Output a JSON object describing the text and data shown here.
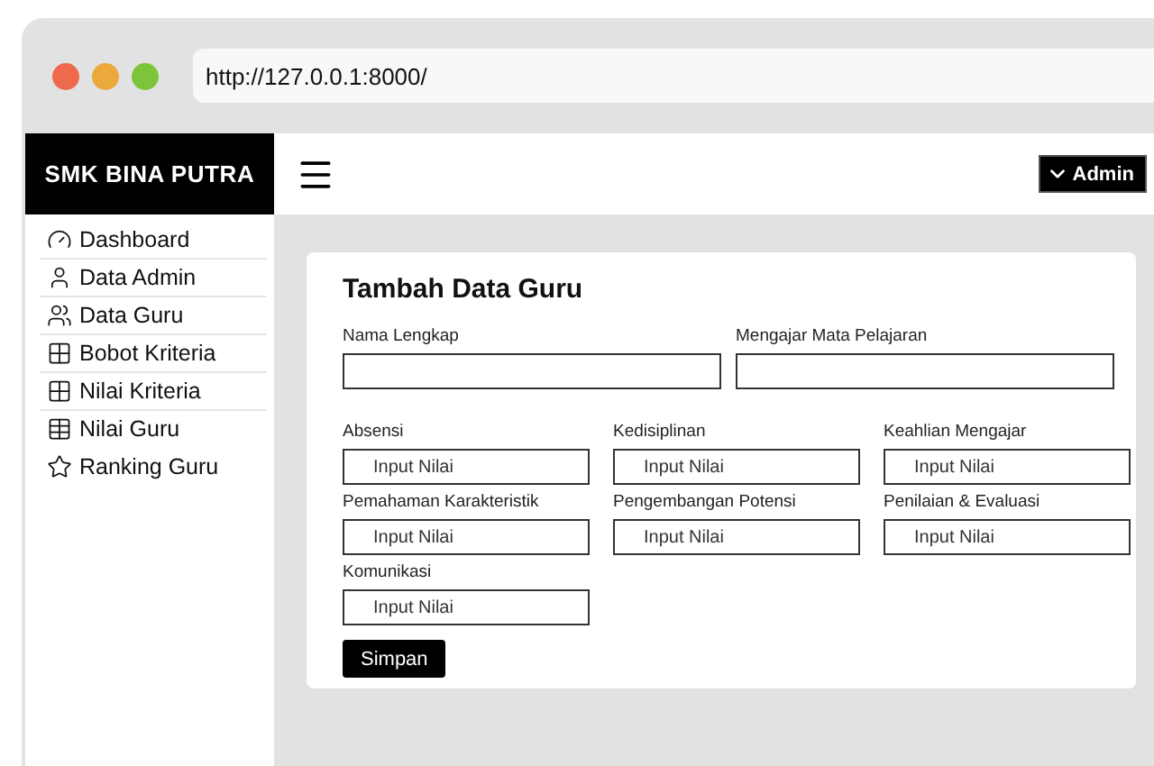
{
  "browser": {
    "url": "http://127.0.0.1:8000/"
  },
  "sidebar": {
    "brand": "SMK BINA PUTRA",
    "items": [
      {
        "label": "Dashboard",
        "kind": "gauge",
        "divider": true
      },
      {
        "label": "Data Admin",
        "kind": "user",
        "divider": true
      },
      {
        "label": "Data Guru",
        "kind": "users",
        "divider": true
      },
      {
        "label": "Bobot Kriteria",
        "kind": "grid",
        "divider": true
      },
      {
        "label": "Nilai Kriteria",
        "kind": "grid",
        "divider": true
      },
      {
        "label": "Nilai Guru",
        "kind": "table",
        "divider": false
      },
      {
        "label": "Ranking Guru",
        "kind": "star",
        "divider": false
      }
    ]
  },
  "topbar": {
    "user_button": "Admin"
  },
  "form": {
    "title": "Tambah Data Guru",
    "text_fields": [
      {
        "label": "Nama Lengkap"
      },
      {
        "label": "Mengajar Mata Pelajaran"
      }
    ],
    "score_fields": [
      {
        "label": "Absensi",
        "placeholder": "Input Nilai"
      },
      {
        "label": "Kedisiplinan",
        "placeholder": "Input Nilai"
      },
      {
        "label": "Keahlian Mengajar",
        "placeholder": "Input Nilai"
      },
      {
        "label": "Pemahaman Karakteristik",
        "placeholder": "Input Nilai"
      },
      {
        "label": "Pengembangan Potensi",
        "placeholder": "Input Nilai"
      },
      {
        "label": "Penilaian & Evaluasi",
        "placeholder": "Input Nilai"
      },
      {
        "label": "Komunikasi",
        "placeholder": "Input Nilai"
      }
    ],
    "submit": "Simpan"
  }
}
